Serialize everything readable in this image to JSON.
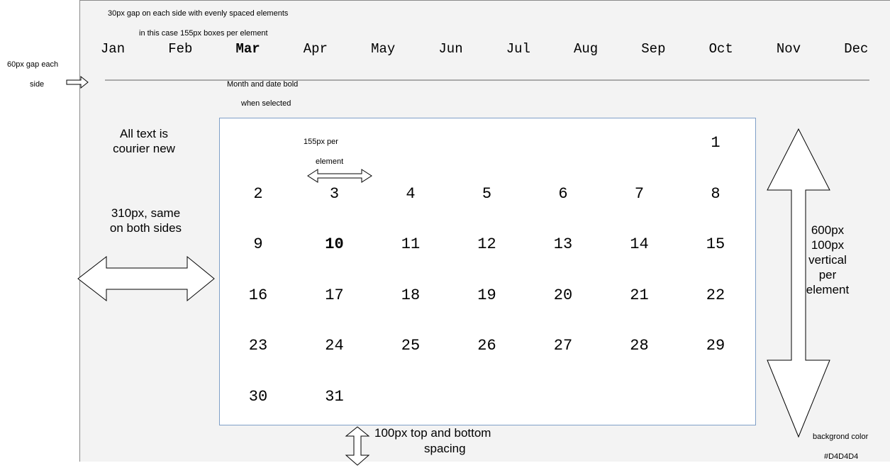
{
  "annotations": {
    "gap_top_line1": "30px gap on each side with evenly spaced elements",
    "gap_top_line2": "in this case 155px boxes per element",
    "side_gap_line1": "60px gap each",
    "side_gap_line2": "side",
    "bold_note_line1": "Month and date bold",
    "bold_note_line2": "when selected",
    "font_note": "All text is courier new",
    "side_width_note": "310px, same on both sides",
    "element_width_line1": "155px per",
    "element_width_line2": "element",
    "vertical_note": "600px 100px vertical per element",
    "spacing_note_line1": "100px top and bottom",
    "spacing_note_line2": "spacing",
    "bg_note_line1": "backgrond color",
    "bg_note_line2": "#D4D4D4"
  },
  "months": [
    "Jan",
    "Feb",
    "Mar",
    "Apr",
    "May",
    "Jun",
    "Jul",
    "Aug",
    "Sep",
    "Oct",
    "Nov",
    "Dec"
  ],
  "selected_month": "Mar",
  "weeks": [
    [
      "",
      "",
      "",
      "",
      "",
      "",
      "1"
    ],
    [
      "2",
      "3",
      "4",
      "5",
      "6",
      "7",
      "8"
    ],
    [
      "9",
      "10",
      "11",
      "12",
      "13",
      "14",
      "15"
    ],
    [
      "16",
      "17",
      "18",
      "19",
      "20",
      "21",
      "22"
    ],
    [
      "23",
      "24",
      "25",
      "26",
      "27",
      "28",
      "29"
    ],
    [
      "30",
      "31",
      "",
      "",
      "",
      "",
      ""
    ]
  ],
  "selected_day": "10",
  "colors": {
    "background_spec": "#D4D4D4",
    "calendar_background": "#FFFFFF"
  }
}
